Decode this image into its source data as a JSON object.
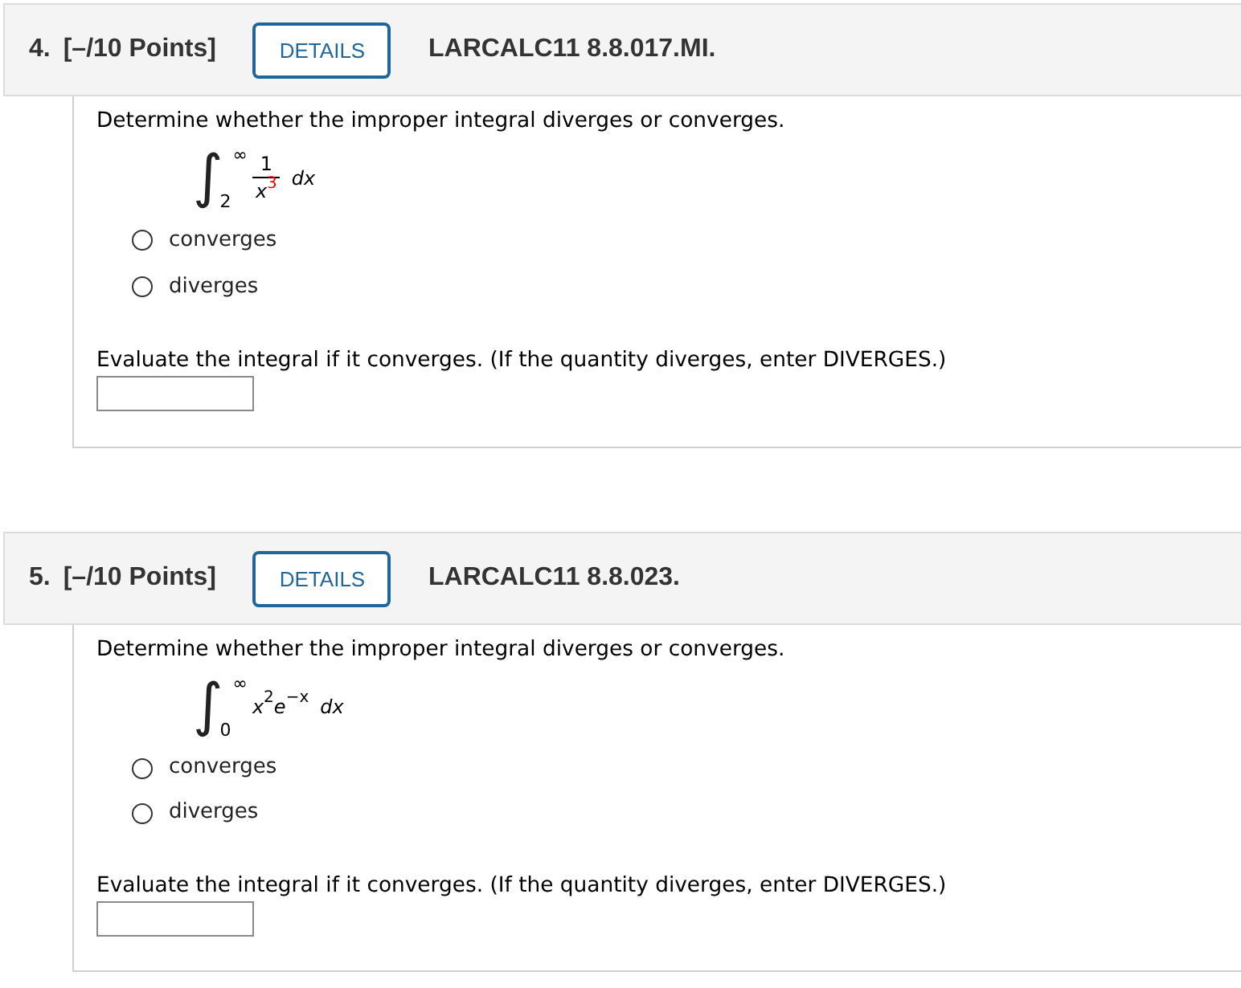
{
  "questions": [
    {
      "number": "4.",
      "points": "[–/10 Points]",
      "details_button": "DETAILS",
      "code": "LARCALC11 8.8.017.MI.",
      "prompt": "Determine whether the improper integral diverges or converges.",
      "integral": {
        "kind": "fraction",
        "symbol": "∫",
        "upper": "∞",
        "lower": "2",
        "numerator": "1",
        "denominator": [
          {
            "base": "x",
            "exponent": "3",
            "highlighted": true
          }
        ],
        "differential": "dx"
      },
      "options": [
        {
          "label": "converges",
          "selected": false
        },
        {
          "label": "diverges",
          "selected": false
        }
      ],
      "evaluate_prompt": "Evaluate the integral if it converges. (If the quantity diverges, enter DIVERGES.)"
    },
    {
      "number": "5.",
      "points": "[–/10 Points]",
      "details_button": "DETAILS",
      "code": "LARCALC11 8.8.023.",
      "prompt": "Determine whether the improper integral diverges or converges.",
      "integral": {
        "kind": "product",
        "symbol": "∫",
        "upper": "∞",
        "lower": "0",
        "factors": [
          {
            "base": "x",
            "exponent": "2",
            "highlighted": false
          },
          {
            "base": "e",
            "exponent": "−x",
            "highlighted": false
          }
        ],
        "differential": "dx"
      },
      "options": [
        {
          "label": "converges",
          "selected": false
        },
        {
          "label": "diverges",
          "selected": false
        }
      ],
      "evaluate_prompt": "Evaluate the integral if it converges. (If the quantity diverges, enter DIVERGES.)"
    }
  ]
}
